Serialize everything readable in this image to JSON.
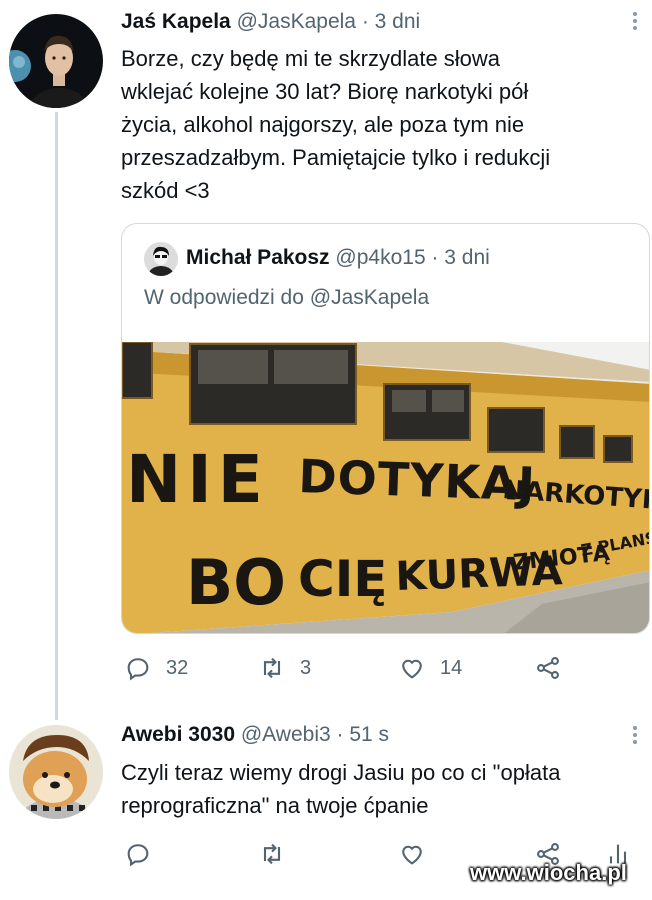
{
  "tweets": [
    {
      "name": "Jaś Kapela",
      "handle": "@JasKapela",
      "time": "· 3 dni",
      "text_lines": [
        "Borze, czy będę mi te skrzydlate słowa",
        "wklejać kolejne 30 lat? Biorę narkotyki pół",
        "życia, alkohol najgorszy, ale poza tym nie",
        "przeszadzałbym. Pamiętajcie tylko i redukcji",
        "szkód <3"
      ],
      "actions": {
        "reply_count": "32",
        "retweet_count": "3",
        "like_count": "14"
      }
    },
    {
      "name": "Awebi 3030",
      "handle": "@Awebi3",
      "time": "· 51 s",
      "text_lines": [
        "Czyli teraz wiemy drogi Jasiu po co ci \"opłata",
        "reprograficzna\" na twoje ćpanie"
      ]
    }
  ],
  "quote": {
    "name": "Michał Pakosz",
    "handle": "@p4ko15",
    "time": "· 3 dni",
    "reply_prefix": "W odpowiedzi do",
    "reply_to": "@JasKapela",
    "image_text": {
      "line1a": "NIE",
      "line1b": "DOTYKAJ",
      "line1c": "NARKOTYKÓW",
      "line2a": "BO",
      "line2b": "CIĘ",
      "line2c": "KURWA",
      "line2d": "ZMIOTĄ",
      "line2e": "Z PLANSZY"
    }
  },
  "watermark": "www.wiocha.pl",
  "icons": [
    "more-icon",
    "reply-icon",
    "retweet-icon",
    "like-icon",
    "share-icon",
    "stats-icon"
  ],
  "colors": {
    "text": "#0f1419",
    "secondary": "#536471",
    "border": "#cfd9de",
    "wall": "#e2b24a"
  }
}
